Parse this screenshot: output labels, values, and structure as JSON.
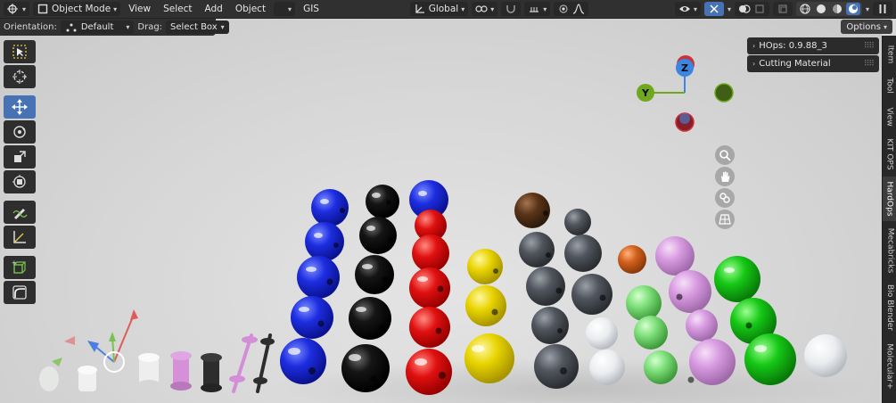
{
  "header": {
    "mode_label": "Object Mode",
    "menus": [
      "View",
      "Select",
      "Add",
      "Object"
    ],
    "gis_label": "GIS",
    "orientation_global": "Global"
  },
  "subbar": {
    "orientation_label": "Orientation:",
    "orientation_value": "Default",
    "drag_label": "Drag:",
    "drag_value": "Select Box",
    "options_label": "Options"
  },
  "npanel": {
    "items": [
      {
        "label": "HOps: 0.9.88_3"
      },
      {
        "label": "Cutting Material"
      }
    ]
  },
  "tabs": [
    "Item",
    "Tool",
    "View",
    "KIT OPS",
    "HardOps",
    "Mecabricks",
    "Bio Blender",
    "Molecular+"
  ],
  "gizmo": {
    "z_label": "Z",
    "y_label": "Y"
  },
  "colors": {
    "active_blue": "#4772b3",
    "axis_x": "#c8343c",
    "axis_y": "#6fa81f",
    "axis_z": "#3d86e0"
  }
}
